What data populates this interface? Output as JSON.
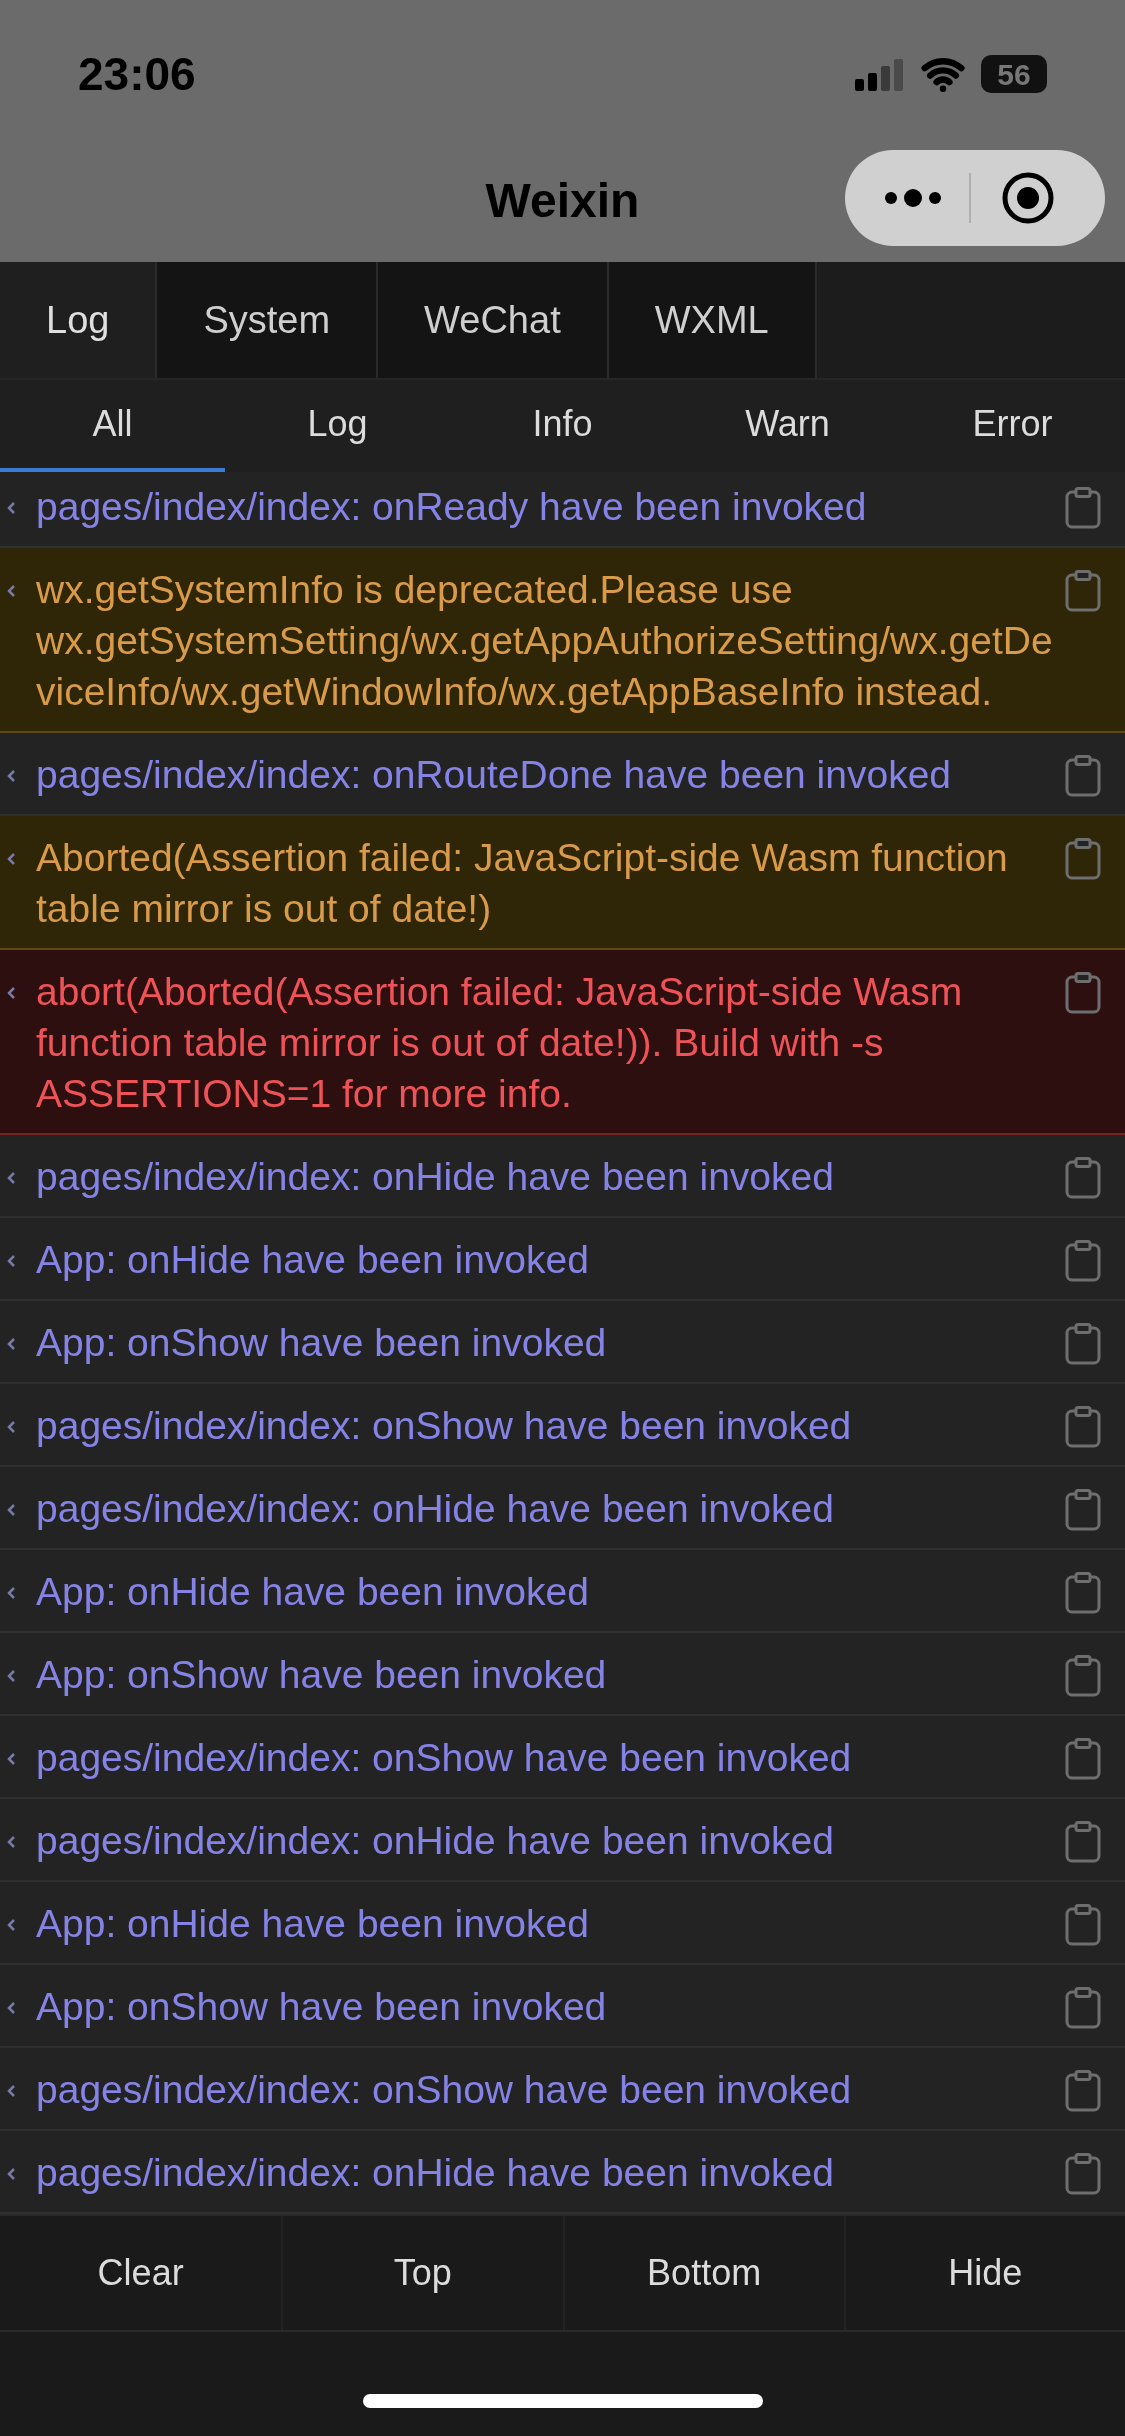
{
  "status_bar": {
    "time": "23:06",
    "battery": "56"
  },
  "nav": {
    "title": "Weixin"
  },
  "tabs": [
    {
      "label": "Log",
      "selected": true
    },
    {
      "label": "System",
      "selected": false
    },
    {
      "label": "WeChat",
      "selected": false
    },
    {
      "label": "WXML",
      "selected": false
    }
  ],
  "filters": [
    {
      "label": "All",
      "selected": true
    },
    {
      "label": "Log",
      "selected": false
    },
    {
      "label": "Info",
      "selected": false
    },
    {
      "label": "Warn",
      "selected": false
    },
    {
      "label": "Error",
      "selected": false
    }
  ],
  "logs": [
    {
      "kind": "log",
      "text": "pages/index/index: onReady have been invoked"
    },
    {
      "kind": "warn",
      "text": "wx.getSystemInfo is deprecated.Please use wx.getSystemSetting/wx.getAppAuthorizeSetting/wx.getDeviceInfo/wx.getWindowInfo/wx.getAppBaseInfo instead."
    },
    {
      "kind": "log",
      "text": "pages/index/index: onRouteDone have been invoked"
    },
    {
      "kind": "warn",
      "text": "Aborted(Assertion failed: JavaScript-side Wasm function table mirror is out of date!)"
    },
    {
      "kind": "error",
      "text": "abort(Aborted(Assertion failed: JavaScript-side Wasm function table mirror is out of date!)). Build with -s ASSERTIONS=1 for more info."
    },
    {
      "kind": "log",
      "text": "pages/index/index: onHide have been invoked"
    },
    {
      "kind": "log",
      "text": "App: onHide have been invoked"
    },
    {
      "kind": "log",
      "text": "App: onShow have been invoked"
    },
    {
      "kind": "log",
      "text": "pages/index/index: onShow have been invoked"
    },
    {
      "kind": "log",
      "text": "pages/index/index: onHide have been invoked"
    },
    {
      "kind": "log",
      "text": "App: onHide have been invoked"
    },
    {
      "kind": "log",
      "text": "App: onShow have been invoked"
    },
    {
      "kind": "log",
      "text": "pages/index/index: onShow have been invoked"
    },
    {
      "kind": "log",
      "text": "pages/index/index: onHide have been invoked"
    },
    {
      "kind": "log",
      "text": "App: onHide have been invoked"
    },
    {
      "kind": "log",
      "text": "App: onShow have been invoked"
    },
    {
      "kind": "log",
      "text": "pages/index/index: onShow have been invoked"
    },
    {
      "kind": "log",
      "text": "pages/index/index: onHide have been invoked"
    }
  ],
  "buttons": [
    "Clear",
    "Top",
    "Bottom",
    "Hide"
  ]
}
